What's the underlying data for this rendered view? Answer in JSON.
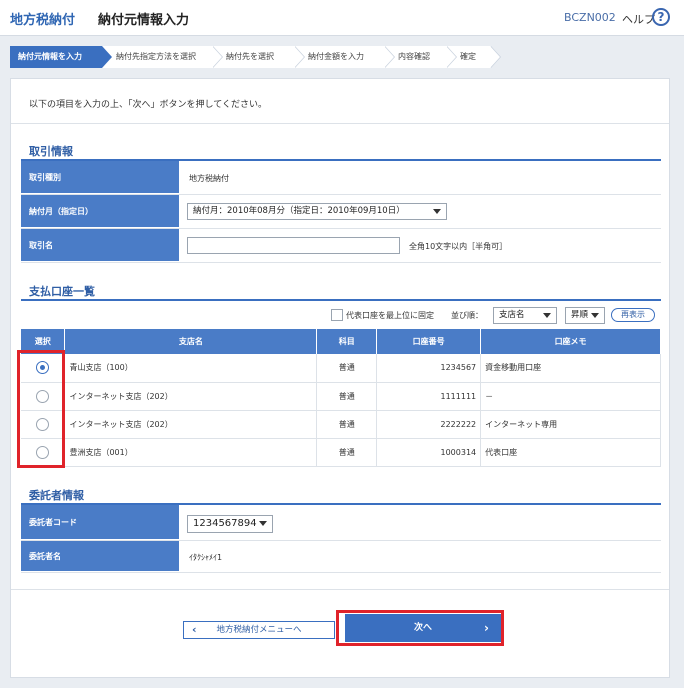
{
  "header": {
    "app_name": "地方税納付",
    "page_title": "納付元情報入力",
    "screen_code": "BCZN002",
    "help_label": "ヘルプ",
    "help_icon": "?"
  },
  "steps": [
    {
      "label": "納付元情報を入力",
      "active": true
    },
    {
      "label": "納付先指定方法を選択",
      "active": false
    },
    {
      "label": "納付先を選択",
      "active": false
    },
    {
      "label": "納付金額を入力",
      "active": false
    },
    {
      "label": "内容確認",
      "active": false
    },
    {
      "label": "確定",
      "active": false
    }
  ],
  "intro": "以下の項目を入力の上、「次へ」ボタンを押してください。",
  "transaction": {
    "title": "取引情報",
    "type_label": "取引種別",
    "type_value": "地方税納付",
    "month_label": "納付月（指定日）",
    "month_value": "納付月：2010年08月分（指定日：2010年09月10日）",
    "name_label": "取引名",
    "name_value": "",
    "name_hint": "全角10文字以内［半角可］"
  },
  "accounts": {
    "title": "支払口座一覧",
    "pin_label": "代表口座を最上位に固定",
    "sort_label": "並び順：",
    "sort_value": "支店名",
    "order_value": "昇順",
    "redisplay_label": "再表示",
    "columns": [
      "選択",
      "支店名",
      "科目",
      "口座番号",
      "口座メモ"
    ],
    "rows": [
      {
        "branch": "青山支店（100）",
        "type": "普通",
        "number": "1234567",
        "memo": "資金移動用口座",
        "selected": true
      },
      {
        "branch": "インターネット支店（202）",
        "type": "普通",
        "number": "1111111",
        "memo": "－",
        "selected": false
      },
      {
        "branch": "インターネット支店（202）",
        "type": "普通",
        "number": "2222222",
        "memo": "インターネット専用",
        "selected": false
      },
      {
        "branch": "豊洲支店（001）",
        "type": "普通",
        "number": "1000314",
        "memo": "代表口座",
        "selected": false
      }
    ]
  },
  "consignor": {
    "title": "委託者情報",
    "code_label": "委託者コード",
    "code_value": "1234567894",
    "name_label": "委託者名",
    "name_value": "ｲﾀｸｼｬﾒｲ1"
  },
  "buttons": {
    "back_label": "地方税納付メニューへ",
    "next_label": "次へ"
  },
  "colors": {
    "accent": "#3a6fc0",
    "highlight": "#e0232a"
  }
}
